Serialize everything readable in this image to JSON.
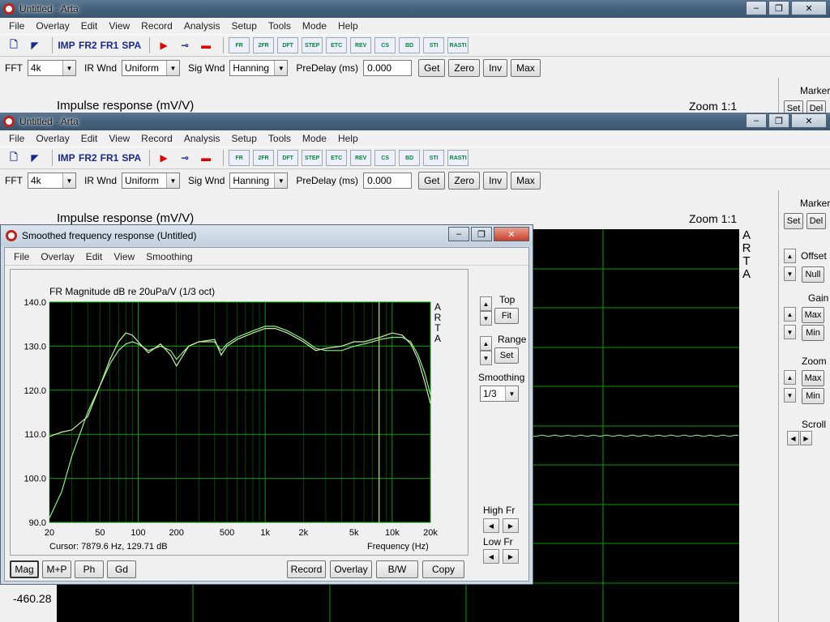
{
  "back_window": {
    "title": "Untitled - Arta",
    "menus": [
      "File",
      "Overlay",
      "Edit",
      "View",
      "Record",
      "Analysis",
      "Setup",
      "Tools",
      "Mode",
      "Help"
    ],
    "toolbar": {
      "imp": "IMP",
      "fr2": "FR2",
      "fr1": "FR1",
      "spa": "SPA",
      "icons": [
        "FR",
        "2FR",
        "DFT",
        "STEP",
        "ETC",
        "REV",
        "CS",
        "BD",
        "STI",
        "RASTI"
      ]
    },
    "controls": {
      "fft_label": "FFT",
      "fft_value": "4k",
      "irwnd_label": "IR Wnd",
      "irwnd_value": "Uniform",
      "sigwnd_label": "Sig Wnd",
      "sigwnd_value": "Hanning",
      "predelay_label": "PreDelay (ms)",
      "predelay_value": "0.000",
      "get": "Get",
      "zero": "Zero",
      "inv": "Inv",
      "max": "Max"
    },
    "plot_title": "Impulse response (mV/V)",
    "zoom": "Zoom 1:1",
    "marker_label": "Marker",
    "set": "Set",
    "del": "Del"
  },
  "main_window": {
    "title": "Untitled - Arta",
    "plot_title": "Impulse response (mV/V)",
    "zoom": "Zoom 1:1",
    "brand_letters": [
      "A",
      "R",
      "T",
      "A"
    ],
    "y_bottom_label": "-460.28",
    "right_panel": {
      "marker": "Marker",
      "set": "Set",
      "del": "Del",
      "offset": "Offset",
      "null": "Null",
      "gain": "Gain",
      "gain_max": "Max",
      "gain_min": "Min",
      "zoom": "Zoom",
      "zoom_max": "Max",
      "zoom_min": "Min",
      "scroll": "Scroll"
    }
  },
  "dialog": {
    "title": "Smoothed frequency response (Untitled)",
    "menus": [
      "File",
      "Overlay",
      "Edit",
      "View",
      "Smoothing"
    ],
    "right": {
      "top": "Top",
      "fit": "Fit",
      "range": "Range",
      "set": "Set",
      "smoothing": "Smoothing",
      "smoothing_value": "1/3",
      "high_fr": "High Fr",
      "low_fr": "Low Fr"
    },
    "cursor": "Cursor: 7879.6 Hz, 129.71 dB",
    "bottom_left": [
      "Mag",
      "M+P",
      "Ph",
      "Gd"
    ],
    "bottom_right": [
      "Record",
      "Overlay",
      "B/W",
      "Copy"
    ]
  },
  "colors": {
    "plot_bg": "#000000",
    "grid": "#00a000",
    "curve": "#c8f0a0",
    "curve2": "#8cf08c"
  },
  "chart_data": {
    "type": "line",
    "title": "FR Magnitude dB re 20uPa/V (1/3 oct)",
    "xlabel": "Frequency (Hz)",
    "ylabel": "",
    "xscale": "log",
    "xlim": [
      20,
      20000
    ],
    "ylim": [
      90,
      140
    ],
    "x_ticks": [
      20,
      50,
      100,
      200,
      500,
      1000,
      2000,
      5000,
      10000,
      20000
    ],
    "x_tick_labels": [
      "20",
      "50",
      "100",
      "200",
      "500",
      "1k",
      "2k",
      "5k",
      "10k",
      "20k"
    ],
    "y_ticks": [
      90,
      100,
      110,
      120,
      130,
      140
    ],
    "y_tick_labels": [
      "90.0",
      "100.0",
      "110.0",
      "120.0",
      "130.0",
      "140.0"
    ],
    "cursor_x": 7879.6,
    "side_label": [
      "A",
      "R",
      "T",
      "A"
    ],
    "series": [
      {
        "x": [
          20,
          25,
          30,
          40,
          50,
          60,
          70,
          80,
          90,
          100,
          120,
          150,
          180,
          200,
          250,
          300,
          400,
          450,
          500,
          600,
          800,
          1000,
          1200,
          1500,
          2000,
          2500,
          3000,
          4000,
          5000,
          6000,
          7000,
          8000,
          10000,
          12000,
          14000,
          16000,
          18000,
          20000
        ],
        "y": [
          91,
          97,
          105,
          115,
          121,
          126,
          129,
          130.5,
          131,
          130.5,
          129,
          130,
          129,
          127,
          130,
          131,
          131,
          129,
          130.5,
          132,
          133.5,
          134.5,
          134.5,
          133.5,
          131.5,
          129.5,
          129,
          129,
          130,
          130.5,
          131,
          131.5,
          132,
          132,
          131,
          128,
          124,
          119
        ]
      },
      {
        "x": [
          20,
          25,
          30,
          40,
          50,
          60,
          70,
          80,
          90,
          100,
          120,
          150,
          180,
          200,
          250,
          300,
          400,
          450,
          500,
          600,
          800,
          1000,
          1200,
          1500,
          2000,
          2500,
          3000,
          4000,
          5000,
          6000,
          7000,
          8000,
          10000,
          12000,
          14000,
          16000,
          18000,
          20000
        ],
        "y": [
          109.5,
          110.5,
          111,
          114,
          121,
          127,
          131,
          133,
          132.5,
          131,
          128.5,
          130.5,
          128,
          125.5,
          130,
          131,
          131.5,
          128,
          130,
          131.5,
          133,
          134,
          134,
          133,
          131,
          129,
          129.5,
          130,
          131,
          131,
          131.5,
          132,
          133,
          132.5,
          130.5,
          127,
          122,
          117
        ]
      }
    ]
  },
  "back_plot": {
    "type": "line",
    "series": [
      {
        "y": [
          0
        ]
      }
    ]
  }
}
